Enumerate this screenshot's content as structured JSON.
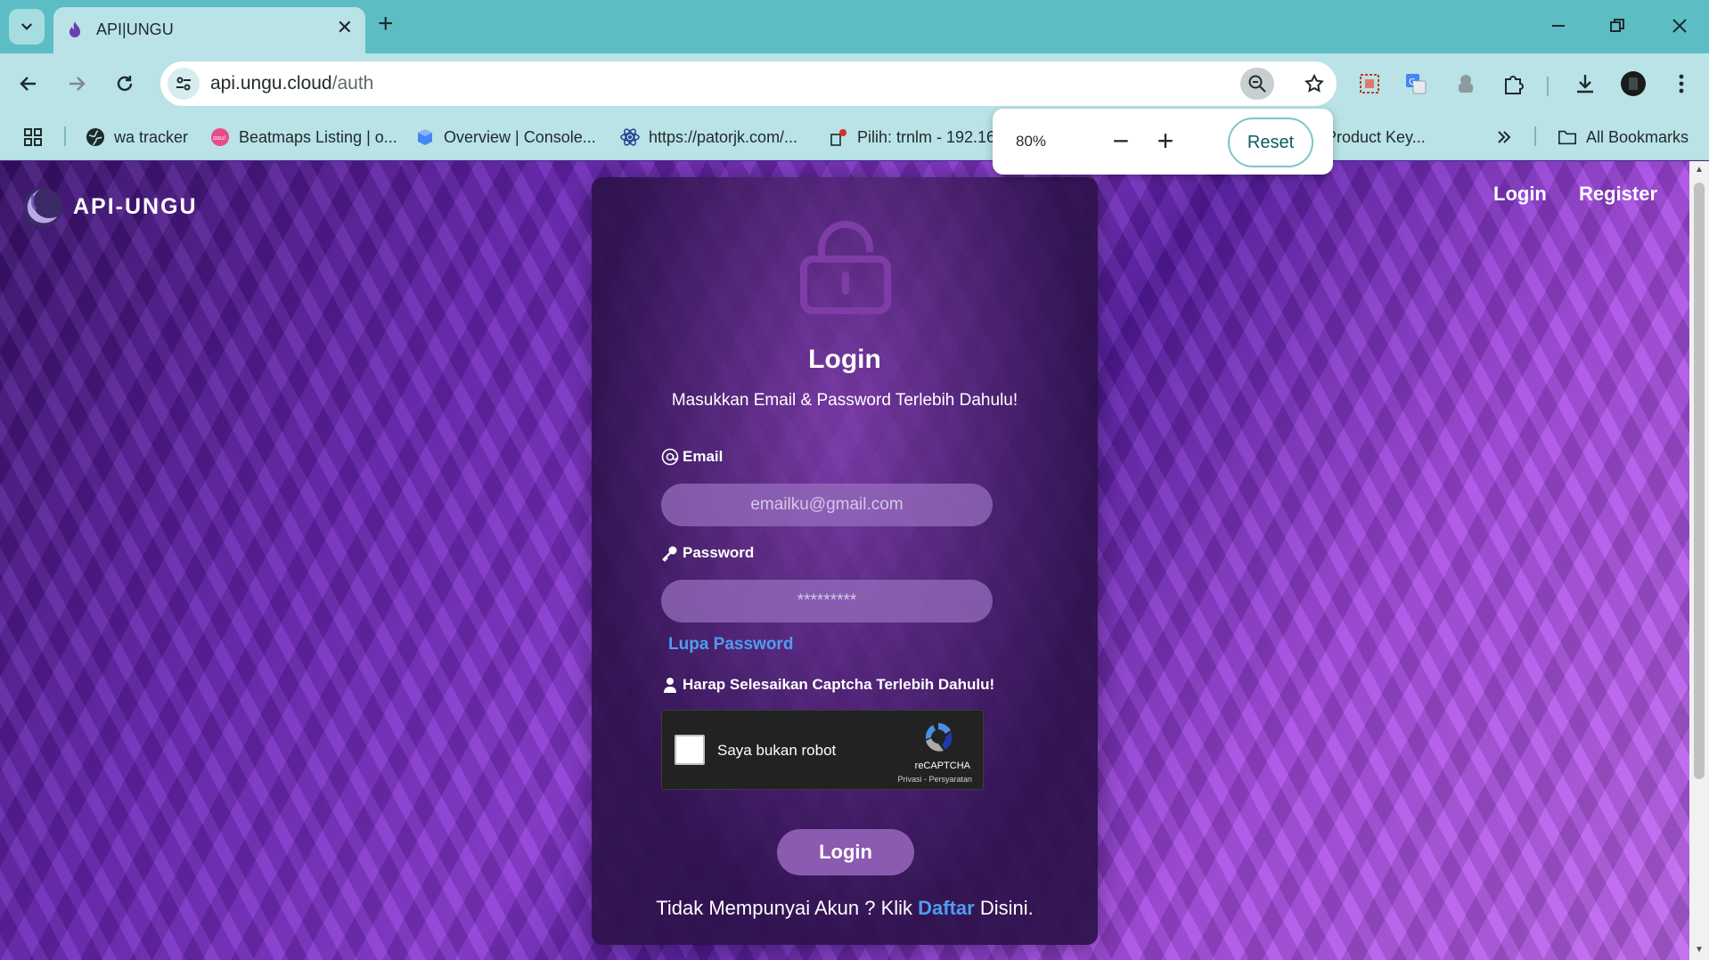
{
  "browser": {
    "tab_title": "API|UNGU",
    "url_host": "api.ungu.cloud",
    "url_path": "/auth",
    "bookmarks": [
      "wa tracker",
      "Beatmaps Listing | o...",
      "Overview | Console...",
      "https://patorjk.com/...",
      "Pilih: trnlm - 192.16",
      "Product Key...",
      "All Bookmarks"
    ],
    "zoom": {
      "level": "80%",
      "minus": "−",
      "plus": "+",
      "reset": "Reset"
    }
  },
  "site": {
    "brand": "API-UNGU",
    "nav": {
      "login": "Login",
      "register": "Register"
    }
  },
  "login_form": {
    "title": "Login",
    "subtitle": "Masukkan Email & Password Terlebih Dahulu!",
    "email_label": "Email",
    "email_placeholder": "emailku@gmail.com",
    "password_label": "Password",
    "password_placeholder": "*********",
    "forgot": "Lupa Password",
    "captcha_note": "Harap Selesaikan Captcha Terlebih Dahulu!",
    "captcha": {
      "label": "Saya bukan robot",
      "brand": "reCAPTCHA",
      "links": "Privasi - Persyaratan"
    },
    "submit": "Login",
    "signup_prefix": "Tidak Mempunyai Akun ? Klik ",
    "signup_link": "Daftar",
    "signup_suffix": " Disini."
  }
}
